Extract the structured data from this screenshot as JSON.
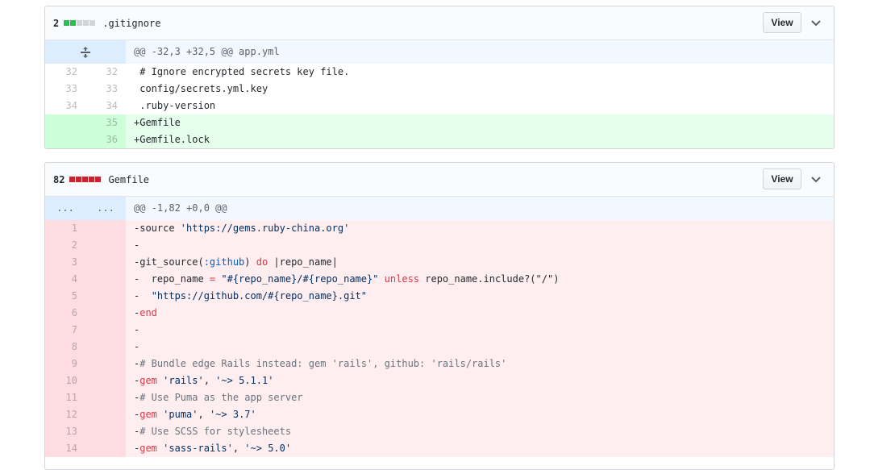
{
  "files": [
    {
      "count": "2",
      "name": ".gitignore",
      "diffstat": [
        "#2cbe4e",
        "#2cbe4e",
        "#d1d5da",
        "#d1d5da",
        "#d1d5da"
      ],
      "view_label": "View",
      "hunk": "@@ -32,3 +32,5 @@ app.yml",
      "lines": [
        {
          "old": "32",
          "new": "32",
          "text": " # Ignore encrypted secrets key file."
        },
        {
          "old": "33",
          "new": "33",
          "text": " config/secrets.yml.key"
        },
        {
          "old": "34",
          "new": "34",
          "text": " .ruby-version"
        },
        {
          "old": "",
          "new": "35",
          "text": "+Gemfile"
        },
        {
          "old": "",
          "new": "36",
          "text": "+Gemfile.lock"
        }
      ]
    },
    {
      "count": "82",
      "name": "Gemfile",
      "diffstat": [
        "#cb2431",
        "#cb2431",
        "#cb2431",
        "#cb2431",
        "#cb2431"
      ],
      "view_label": "View",
      "hunk_ellipsis": "...",
      "hunk": "@@ -1,82 +0,0 @@",
      "lines": [
        {
          "old": "1",
          "text_a": "-source ",
          "text_b": "'https://gems.ruby-china.org'"
        },
        {
          "old": "2",
          "text_a": "-"
        },
        {
          "old": "3",
          "text_a": "-git_source(",
          "text_b": ":github",
          "text_c": ") ",
          "text_d": "do",
          "text_e": " |repo_name|"
        },
        {
          "old": "4",
          "text_a": "-  repo_name ",
          "text_b": "=",
          "text_c": " \"#{repo_name}/#{repo_name}\"",
          "text_d": " unless",
          "text_e": " repo_name.include?(\"/\")"
        },
        {
          "old": "5",
          "text_a": "-  ",
          "text_b": "\"https://github.com/#{repo_name}.git\""
        },
        {
          "old": "6",
          "text_a": "-",
          "text_b": "end"
        },
        {
          "old": "7",
          "text_a": "-"
        },
        {
          "old": "8",
          "text_a": "-"
        },
        {
          "old": "9",
          "text_a": "-",
          "text_b": "# Bundle edge Rails instead: gem 'rails', github: 'rails/rails'"
        },
        {
          "old": "10",
          "text_a": "-",
          "text_b": "gem",
          "text_c": " 'rails'",
          ", ": "",
          "text_d": ", ",
          "text_e": "'~> 5.1.1'"
        },
        {
          "old": "11",
          "text_a": "-",
          "text_b": "# Use Puma as the app server"
        },
        {
          "old": "12",
          "text_a": "-",
          "text_b": "gem",
          "text_c": " 'puma'",
          "text_d": ", ",
          "text_e": "'~> 3.7'"
        },
        {
          "old": "13",
          "text_a": "-",
          "text_b": "# Use SCSS for stylesheets"
        },
        {
          "old": "14",
          "text_a": "-",
          "text_b": "gem",
          "text_c": " 'sass-rails'",
          "text_d": ", ",
          "text_e": "'~> 5.0'"
        }
      ]
    }
  ]
}
